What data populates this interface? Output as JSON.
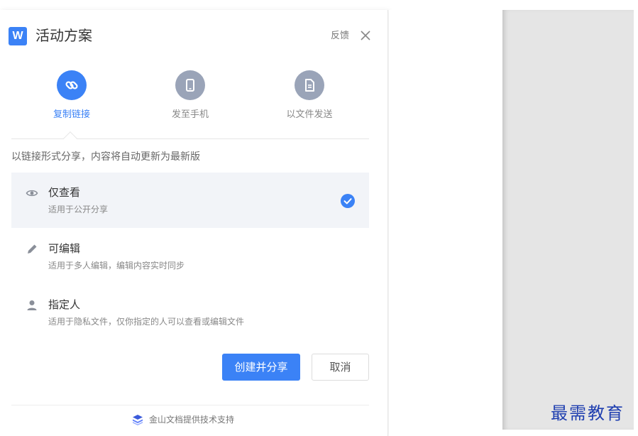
{
  "dialog": {
    "app_logo_letter": "W",
    "title": "活动方案",
    "feedback_label": "反馈",
    "close_icon": "close-x-icon"
  },
  "tabs": [
    {
      "label": "复制链接",
      "icon": "link-icon",
      "active": true
    },
    {
      "label": "发至手机",
      "icon": "phone-icon",
      "active": false
    },
    {
      "label": "以文件发送",
      "icon": "document-icon",
      "active": false
    }
  ],
  "description": "以链接形式分享，内容将自动更新为最新版",
  "options": [
    {
      "name": "仅查看",
      "sub": "适用于公开分享",
      "icon": "eye-icon",
      "selected": true
    },
    {
      "name": "可编辑",
      "sub": "适用于多人编辑，编辑内容实时同步",
      "icon": "pencil-icon",
      "selected": false
    },
    {
      "name": "指定人",
      "sub": "适用于隐私文件，仅你指定的人可以查看或编辑文件",
      "icon": "person-icon",
      "selected": false
    }
  ],
  "buttons": {
    "primary": "创建并分享",
    "cancel": "取消"
  },
  "footer": {
    "text": "金山文档提供技术支持",
    "icon": "stack-icon"
  },
  "watermark": "最需教育",
  "colors": {
    "accent": "#3b82f6",
    "tab_inactive": "#9aa4b8",
    "selected_bg": "#f2f4f8",
    "watermark": "#1f3fb0",
    "doc_page": "#e5e5e5"
  }
}
